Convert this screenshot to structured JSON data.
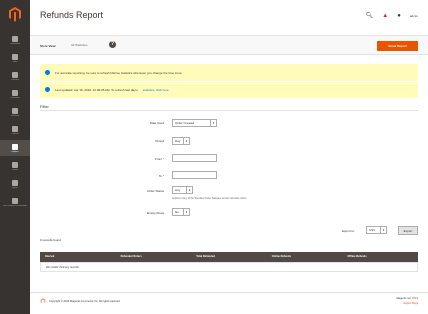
{
  "page": {
    "title": "Refunds Report"
  },
  "colors": {
    "sidebar": "#373330",
    "accent": "#eb5202",
    "notice": "#fffbbb",
    "info": "#007bdb",
    "grid_header": "#514943"
  },
  "sidebar": {
    "logo_icon": "magento-logo-icon",
    "items": [
      {
        "label": "Dashboard",
        "icon": "dashboard-icon",
        "active": false
      },
      {
        "label": "Sales",
        "icon": "dollar-icon",
        "active": false
      },
      {
        "label": "Products",
        "icon": "box-icon",
        "active": false
      },
      {
        "label": "Customers",
        "icon": "person-icon",
        "active": false
      },
      {
        "label": "Marketing",
        "icon": "megaphone-icon",
        "active": false
      },
      {
        "label": "Content",
        "icon": "layout-icon",
        "active": false
      },
      {
        "label": "Reports",
        "icon": "bar-chart-icon",
        "active": true
      },
      {
        "label": "Stores",
        "icon": "store-icon",
        "active": false
      },
      {
        "label": "System",
        "icon": "gear-icon",
        "active": false
      },
      {
        "label": "Find Partners & Extensions",
        "icon": "puzzle-icon",
        "active": false
      }
    ]
  },
  "header": {
    "search_icon": "search-icon",
    "notifications_icon": "bell-icon",
    "user_icon": "user-icon",
    "user_label": "admin"
  },
  "toolbar": {
    "scope_label": "Store View:",
    "scope_value": "All Websites",
    "help_icon": "question-icon",
    "show_report_label": "Show Report"
  },
  "messages": [
    {
      "text": "For accurate reporting, be sure to refresh lifetime statistics whenever you change the time zone.",
      "link": ""
    },
    {
      "text": "Last updated: Apr 16, 2016, 12:09:05 AM. To refresh last day's",
      "link": "statistics, click here."
    }
  ],
  "filter": {
    "title": "Filter",
    "date_used_label": "Date Used",
    "date_used_value": "Order Created",
    "period_label": "Period",
    "period_value": "Day",
    "from_label": "From",
    "to_label": "To",
    "order_status_label": "Order Status",
    "order_status_value": "Any",
    "order_status_note": "Applies to Any of the Specified Order Statuses except canceled orders",
    "empty_rows_label": "Empty Rows",
    "empty_rows_value": "No"
  },
  "grid": {
    "records_found": "0 records found",
    "export_to_label": "Export to:",
    "export_format": "CSV",
    "export_button": "Export",
    "columns": [
      "Interval",
      "Refunded Orders",
      "Total Refunded",
      "Online Refunds",
      "Offline Refunds"
    ],
    "empty_message": "We couldn't find any records."
  },
  "footer": {
    "copyright": "Copyright © 2016 Magento Commerce Inc. All rights reserved.",
    "version": "Magento ver. 2.0.4",
    "report_bugs": "Report Bugs"
  }
}
